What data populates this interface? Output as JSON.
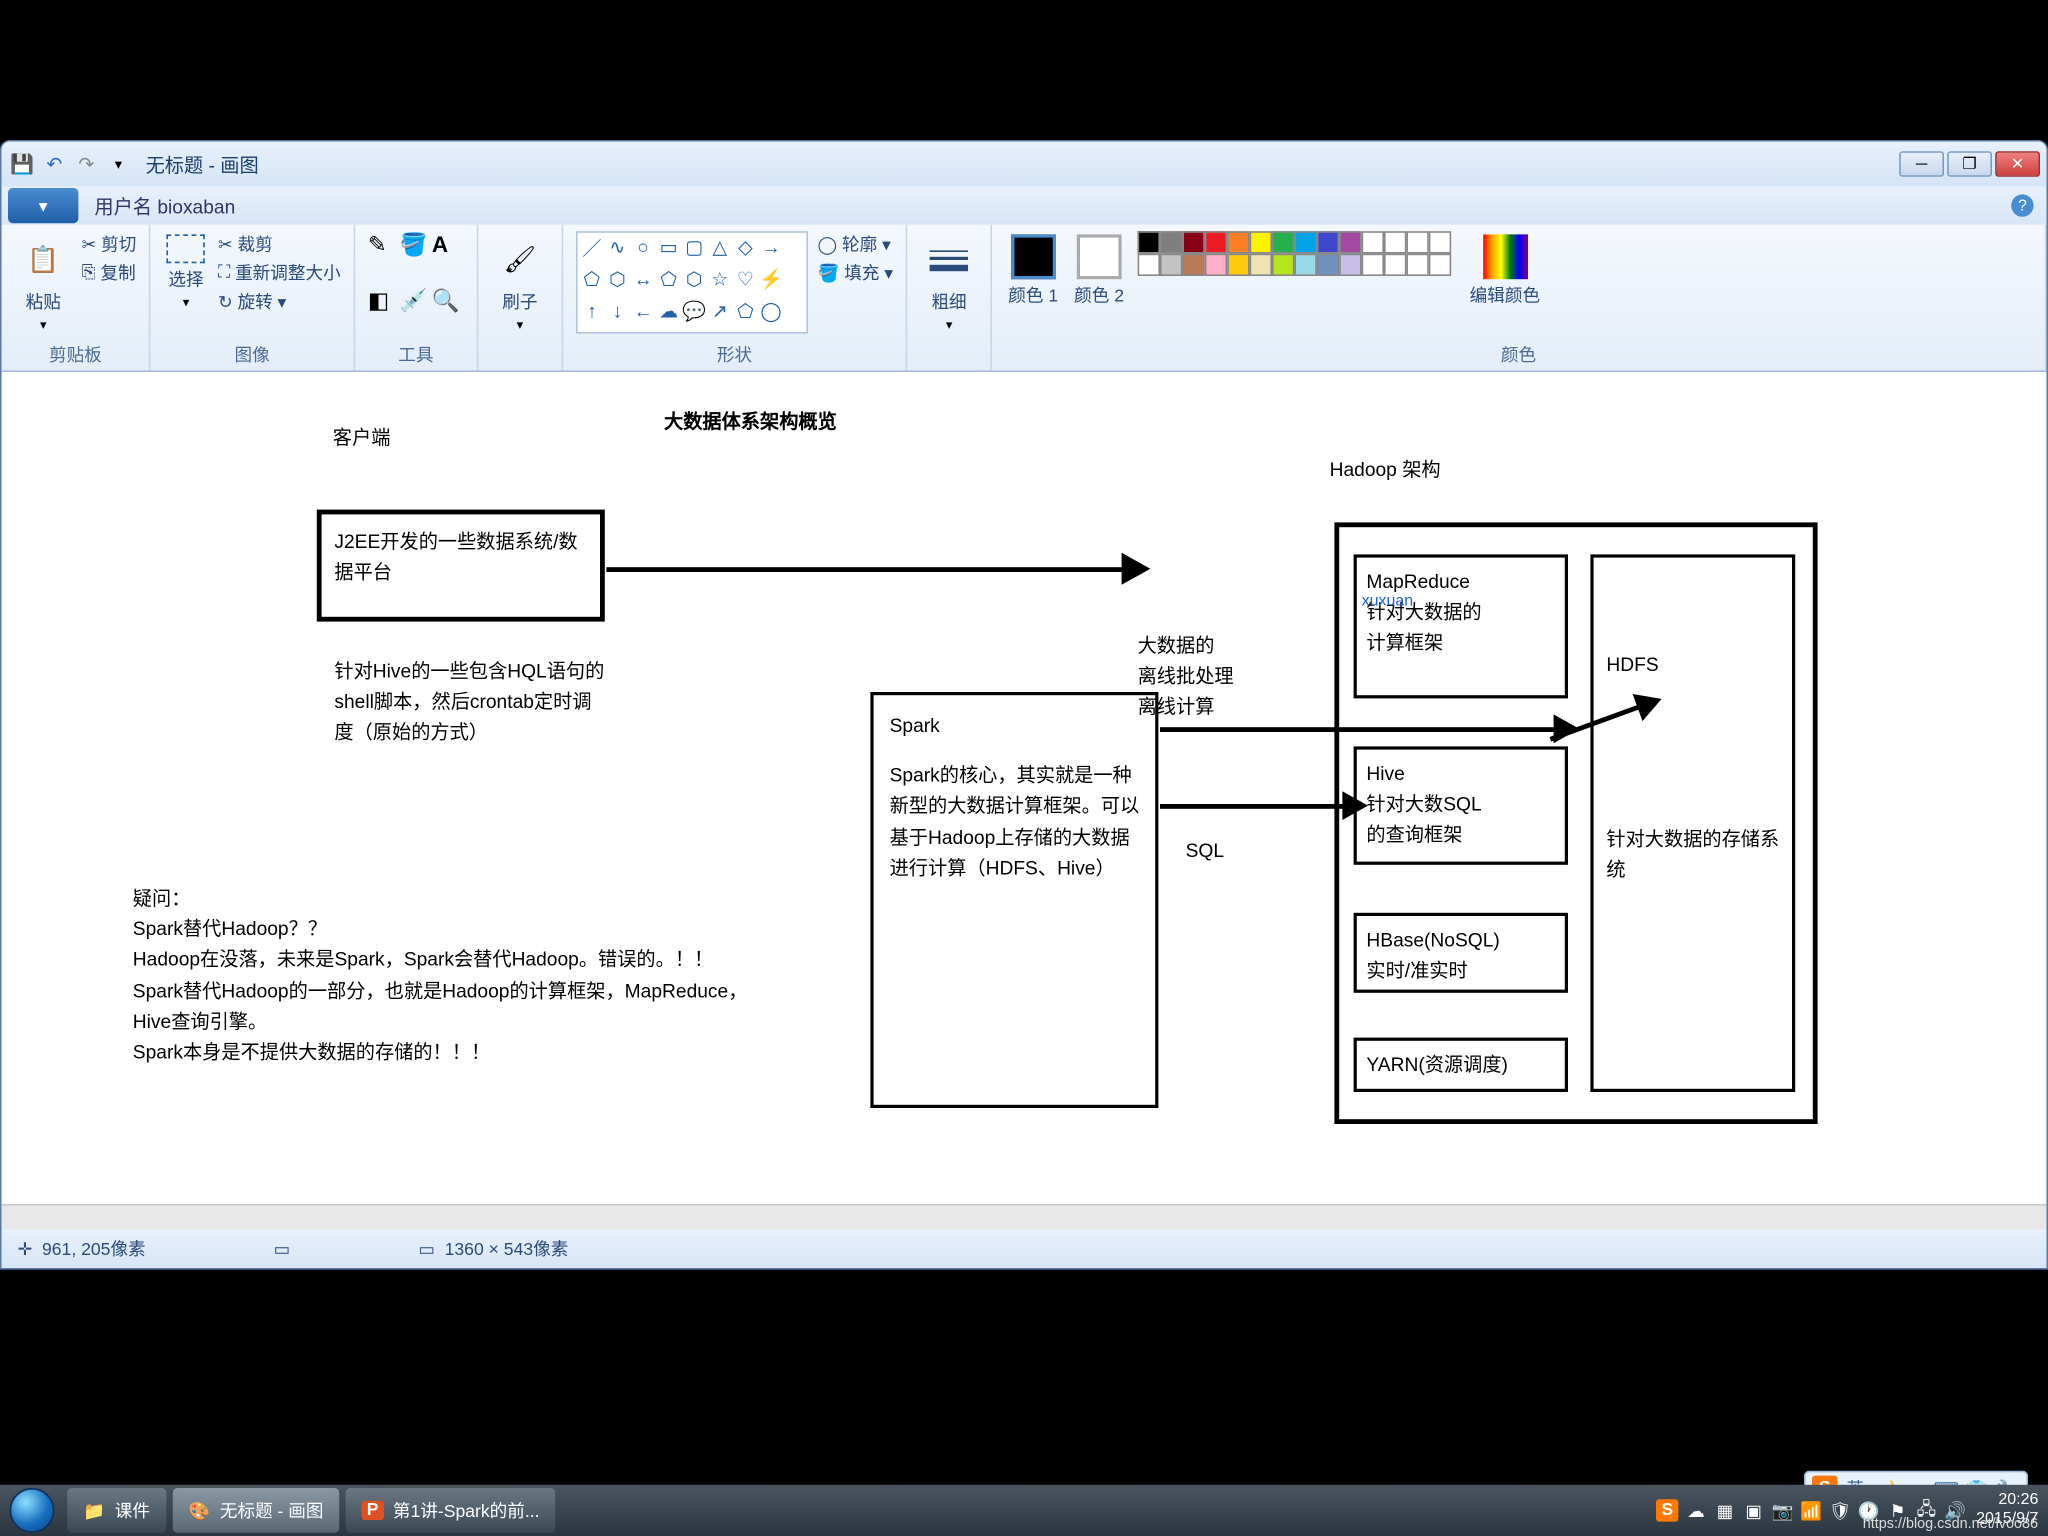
{
  "title": "无标题 - 画图",
  "tab": "用户名 bioxaban",
  "ribbon": {
    "groups": {
      "clipboard": {
        "label": "剪贴板",
        "paste": "粘贴",
        "cut": "剪切",
        "copy": "复制"
      },
      "image": {
        "label": "图像",
        "select": "选择",
        "resize": "重新调整大小",
        "rotate": "旋转"
      },
      "tools": {
        "label": "工具"
      },
      "brushes": {
        "label": "刷子"
      },
      "shapes": {
        "label": "形状",
        "outline": "轮廓",
        "fill": "填充"
      },
      "thickness": {
        "label": "粗细"
      },
      "colors": {
        "label": "颜色",
        "color1": "颜色 1",
        "color2": "颜色 2",
        "edit": "编辑颜色"
      }
    }
  },
  "status": {
    "coords": "961, 205像素",
    "size": "1360 × 543像素"
  },
  "ime": {
    "lang": "英"
  },
  "taskbar": {
    "items": [
      {
        "icon": "folder",
        "label": "课件"
      },
      {
        "icon": "paint",
        "label": "无标题 - 画图"
      },
      {
        "icon": "ppt",
        "label": "第1讲-Spark的前..."
      }
    ],
    "time": "20:26",
    "date": "2015/9/7"
  },
  "canvas": {
    "title": "大数据体系架构概览",
    "client_label": "客户端",
    "hadoop_label": "Hadoop 架构",
    "j2ee": "J2EE开发的一些数据系统/数据平台",
    "hive_note": "针对Hive的一些包含HQL语句的shell脚本，然后crontab定时调度（原始的方式）",
    "question": "疑问：\nSpark替代Hadoop？？\nHadoop在没落，未来是Spark，Spark会替代Hadoop。错误的。！！\nSpark替代Hadoop的一部分，也就是Hadoop的计算框架，MapReduce，Hive查询引擎。\nSpark本身是不提供大数据的存储的！！！",
    "spark_title": "Spark",
    "spark_body": "Spark的核心，其实就是一种新型的大数据计算框架。可以基于Hadoop上存储的大数据进行计算（HDFS、Hive）",
    "arrow1_note": "大数据的\n离线批处理\n离线计算",
    "sql_note": "SQL",
    "mapreduce": "MapReduce\n针对大数据的\n计算框架",
    "watermark_mr": "xuxuan",
    "hive": "Hive\n针对大数SQL\n的查询框架",
    "hbase": "HBase(NoSQL)\n实时/准实时",
    "yarn": "YARN(资源调度)",
    "hdfs": "HDFS",
    "hdfs_note": "针对大数据的存储系统"
  },
  "watermark": "https://blog.csdn.net/lvoo86"
}
